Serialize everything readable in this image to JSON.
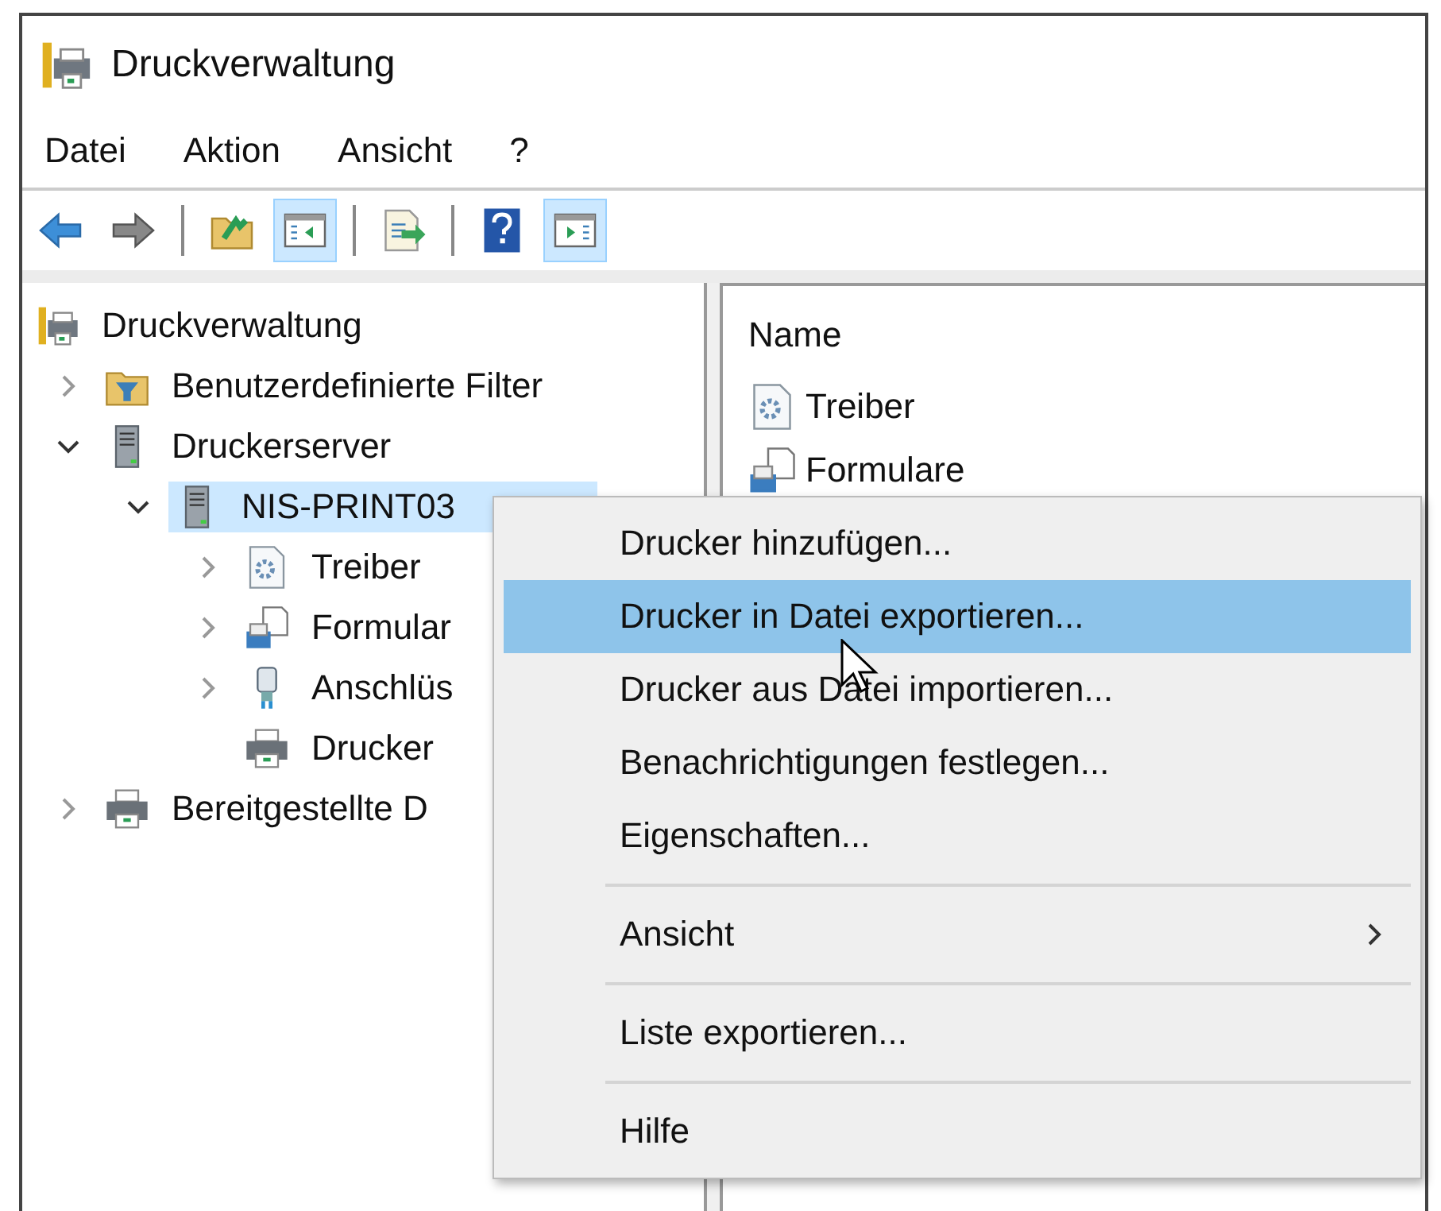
{
  "window": {
    "title": "Druckverwaltung"
  },
  "menubar": [
    "Datei",
    "Aktion",
    "Ansicht",
    "?"
  ],
  "toolbar": [
    [
      {
        "kind": "back",
        "on": false
      },
      {
        "kind": "forward",
        "on": false
      }
    ],
    [
      {
        "kind": "up",
        "on": false
      },
      {
        "kind": "tree-pane",
        "on": true
      }
    ],
    [
      {
        "kind": "export",
        "on": false
      }
    ],
    [
      {
        "kind": "help",
        "on": false
      },
      {
        "kind": "action-pane",
        "on": true
      }
    ]
  ],
  "tree": [
    {
      "label": "Druckverwaltung",
      "kind": "management",
      "selected": false,
      "children": [
        {
          "label": "Benutzerdefinierte Filter",
          "kind": "filter",
          "expanded": false,
          "selected": false
        },
        {
          "label": "Druckerserver",
          "kind": "server",
          "expanded": true,
          "selected": false,
          "children": [
            {
              "label": "NIS-PRINT03",
              "kind": "server",
              "expanded": true,
              "selected": true,
              "children": [
                {
                  "label": "Treiber",
                  "kind": "driver",
                  "expanded": false,
                  "selected": false
                },
                {
                  "label": "Formular",
                  "kind": "forms",
                  "expanded": false,
                  "selected": false
                },
                {
                  "label": "Anschlüs",
                  "kind": "port",
                  "expanded": false,
                  "selected": false
                },
                {
                  "label": "Drucker",
                  "kind": "printer",
                  "selected": false
                }
              ]
            }
          ]
        },
        {
          "label": "Bereitgestellte D",
          "kind": "printer",
          "expanded": false,
          "selected": false
        }
      ]
    }
  ],
  "list": {
    "columns": [
      "Name"
    ],
    "rows": [
      {
        "label": "Treiber",
        "kind": "driver"
      },
      {
        "label": "Formulare",
        "kind": "forms"
      }
    ]
  },
  "context_menu": {
    "groups": [
      [
        {
          "label": "Drucker hinzufügen...",
          "kind": "command",
          "selected": false
        },
        {
          "label": "Drucker in Datei exportieren...",
          "kind": "command",
          "selected": true
        },
        {
          "label": "Drucker aus Datei importieren...",
          "kind": "command",
          "selected": false
        },
        {
          "label": "Benachrichtigungen festlegen...",
          "kind": "command",
          "selected": false
        },
        {
          "label": "Eigenschaften...",
          "kind": "command",
          "selected": false
        }
      ],
      [
        {
          "label": "Ansicht",
          "kind": "submenu",
          "selected": false
        }
      ],
      [
        {
          "label": "Liste exportieren...",
          "kind": "command",
          "selected": false
        }
      ],
      [
        {
          "label": "Hilfe",
          "kind": "command",
          "selected": false
        }
      ]
    ]
  }
}
